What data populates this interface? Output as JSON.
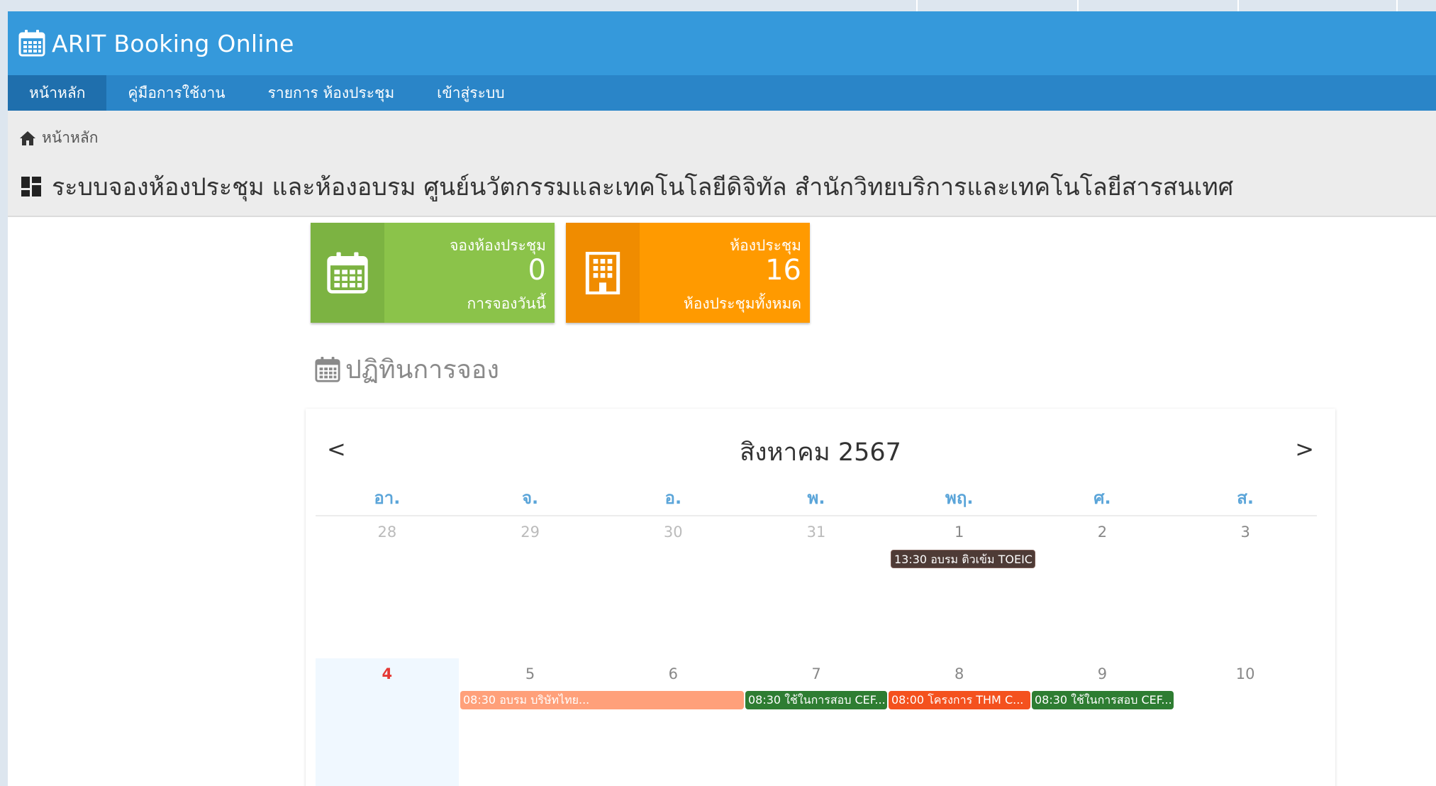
{
  "app": {
    "title": "ARIT Booking Online"
  },
  "nav": {
    "items": [
      {
        "label": "หน้าหลัก",
        "active": true
      },
      {
        "label": "คู่มือการใช้งาน"
      },
      {
        "label": "รายการ ห้องประชุม"
      },
      {
        "label": "เข้าสู่ระบบ"
      }
    ]
  },
  "breadcrumb": {
    "home": "หน้าหลัก"
  },
  "page_title": "ระบบจองห้องประชุม และห้องอบรม ศูนย์นวัตกรรมและเทคโนโลยีดิจิทัล สำนักวิทยบริการและเทคโนโลยีสารสนเทศ",
  "stats": {
    "bookings": {
      "label": "จองห้องประชุม",
      "value": "0",
      "sub": "การจองวันนี้",
      "color": "#8bc34a",
      "icon": "calendar-icon"
    },
    "rooms": {
      "label": "ห้องประชุม",
      "value": "16",
      "sub": "ห้องประชุมทั้งหมด",
      "color": "#ff9a00",
      "icon": "building-icon"
    }
  },
  "calendar": {
    "heading": "ปฏิทินการจอง",
    "month_title": "สิงหาคม 2567",
    "prev": "<",
    "next": ">",
    "weekdays": [
      "อา.",
      "จ.",
      "อ.",
      "พ.",
      "พฤ.",
      "ศ.",
      "ส."
    ],
    "weeks": [
      [
        "28",
        "29",
        "30",
        "31",
        "1",
        "2",
        "3"
      ],
      [
        "4",
        "5",
        "6",
        "7",
        "8",
        "9",
        "10"
      ]
    ],
    "events": [
      {
        "label": "13:30 อบรม ติวเข้ม TOEIC",
        "color": "#4e3b36"
      },
      {
        "label": "08:30 อบรม บริษัทไทย...",
        "color": "#ffa07a"
      },
      {
        "label": "08:30 ใช้ในการสอบ CEF...",
        "color": "#2e7d32"
      },
      {
        "label": "08:00 โครงการ THM C...",
        "color": "#f4511e"
      },
      {
        "label": "08:30 ใช้ในการสอบ CEF...",
        "color": "#2e7d32"
      }
    ]
  }
}
